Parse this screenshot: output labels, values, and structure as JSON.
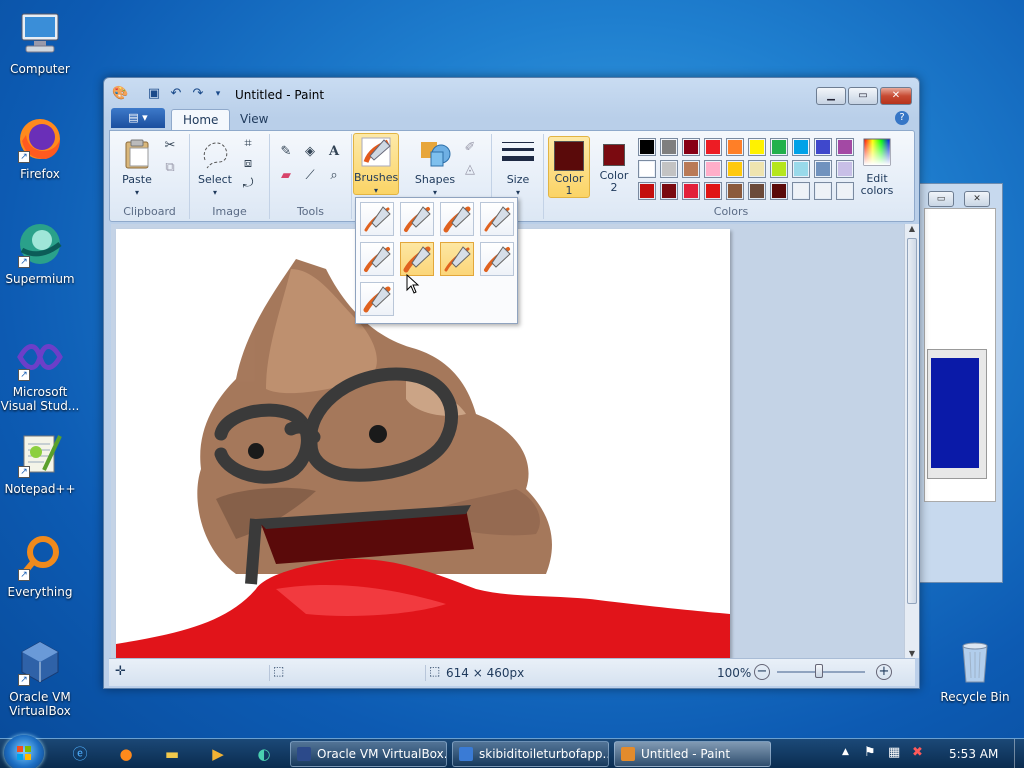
{
  "desktop": {
    "icons": [
      {
        "label": "Computer",
        "icon": "computer-icon"
      },
      {
        "label": "Firefox",
        "icon": "firefox-icon"
      },
      {
        "label": "Supermium",
        "icon": "supermium-icon"
      },
      {
        "label": "Microsoft Visual Stud...",
        "icon": "visual-studio-icon"
      },
      {
        "label": "Notepad++",
        "icon": "notepadpp-icon"
      },
      {
        "label": "Everything",
        "icon": "everything-icon"
      },
      {
        "label": "Oracle VM VirtualBox",
        "icon": "virtualbox-icon"
      },
      {
        "label": "Recycle Bin",
        "icon": "recycle-bin-icon"
      }
    ]
  },
  "paint": {
    "title": "Untitled - Paint",
    "file_menu_label": "▤ ▾",
    "tabs": [
      "Home",
      "View"
    ],
    "groups": {
      "clipboard": {
        "label": "Clipboard",
        "paste": "Paste"
      },
      "image": {
        "label": "Image",
        "select": "Select"
      },
      "tools": {
        "label": "Tools"
      },
      "brushes": {
        "label": "Brushes"
      },
      "shapes": {
        "label": "Shapes"
      },
      "size": {
        "label": "Size"
      },
      "colors": {
        "label": "Colors",
        "color1": "Color\n1",
        "color2": "Color\n2",
        "edit": "Edit colors"
      }
    },
    "color1": "#5a0a0a",
    "color2": "#7a0a10",
    "palette_row1": [
      "#000000",
      "#7f7f7f",
      "#880015",
      "#ed1c24",
      "#ff7f27",
      "#fff200",
      "#22b14c",
      "#00a2e8",
      "#3f48cc",
      "#a349a4"
    ],
    "palette_row2": [
      "#ffffff",
      "#c3c3c3",
      "#b97a57",
      "#ffaec9",
      "#ffc90e",
      "#efe4b0",
      "#b5e61d",
      "#99d9ea",
      "#7092be",
      "#c8bfe7"
    ],
    "palette_row3": [
      "#c40e0e",
      "#7a0a10",
      "#e2203a",
      "#e01515",
      "#8b5a3c",
      "#6b4a3a",
      "#5a0a0a",
      "#eef2f7",
      "#eef2f7",
      "#eef2f7"
    ],
    "status": {
      "dimensions": "614 × 460px",
      "zoom": "100%"
    },
    "brush_dropdown": {
      "count": 9,
      "selected_index": 5
    }
  },
  "taskbar": {
    "tasks": [
      {
        "label": "Oracle VM VirtualBox...",
        "color": "#2c4a8a"
      },
      {
        "label": "skibiditoileturbofapp...",
        "color": "#3a7bd5"
      },
      {
        "label": "Untitled - Paint",
        "color": "#e38b2c"
      }
    ],
    "clock": "5:53 AM"
  }
}
